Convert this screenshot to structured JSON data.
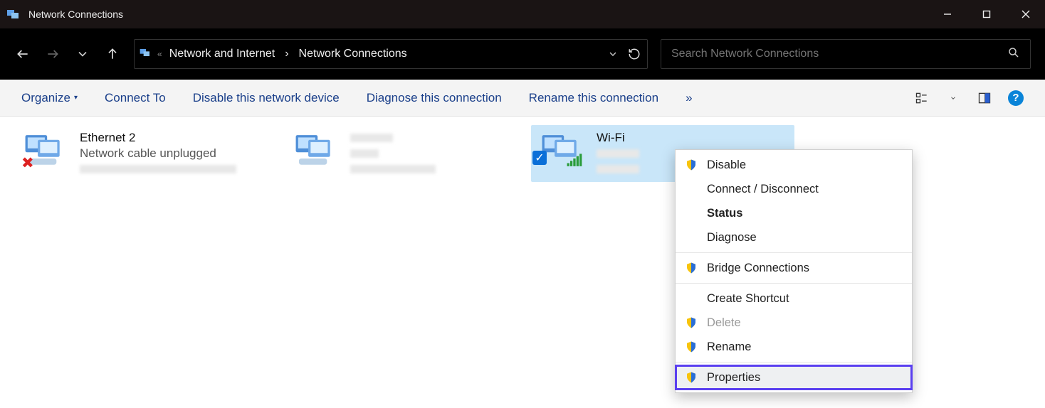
{
  "window": {
    "title": "Network Connections"
  },
  "breadcrumb": {
    "parent": "Network and Internet",
    "current": "Network Connections"
  },
  "search": {
    "placeholder": "Search Network Connections"
  },
  "toolbar": {
    "organize": "Organize",
    "connect_to": "Connect To",
    "disable": "Disable this network device",
    "diagnose": "Diagnose this connection",
    "rename": "Rename this connection",
    "overflow": "»"
  },
  "connections": [
    {
      "name": "Ethernet 2",
      "status": "Network cable unplugged"
    },
    {
      "name": "",
      "status": ""
    },
    {
      "name": "Wi-Fi",
      "selected": true
    }
  ],
  "context_menu": {
    "disable": "Disable",
    "connect": "Connect / Disconnect",
    "status": "Status",
    "diagnose": "Diagnose",
    "bridge": "Bridge Connections",
    "shortcut": "Create Shortcut",
    "delete": "Delete",
    "rename": "Rename",
    "properties": "Properties"
  }
}
